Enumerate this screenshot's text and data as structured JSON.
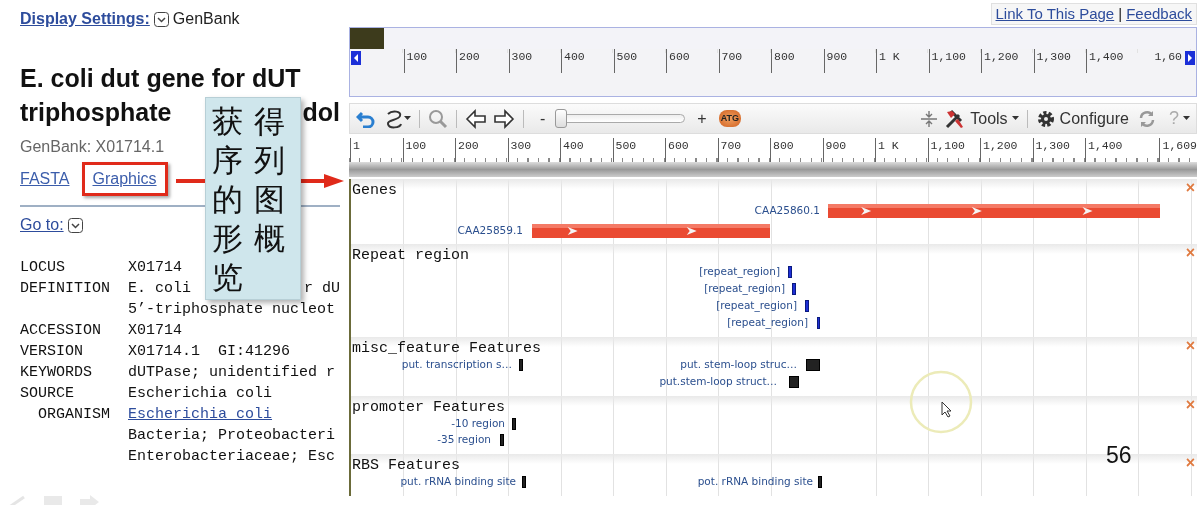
{
  "header": {
    "display_settings": "Display Settings:",
    "format": "GenBank"
  },
  "title_lines": [
    {
      "parts": [
        "E. coli dut gene for dUT"
      ]
    },
    {
      "parts": [
        "triphosphate",
        "dol"
      ]
    }
  ],
  "accession": "GenBank: X01714.1",
  "links": [
    {
      "label": "FASTA",
      "highlighted": false
    },
    {
      "label": "Graphics",
      "highlighted": true
    }
  ],
  "goto": "Go to:",
  "record": [
    {
      "key": "LOCUS",
      "lines": [
        {
          "kind": "text",
          "parts": [
            "X01714"
          ]
        }
      ]
    },
    {
      "key": "DEFINITION",
      "lines": [
        {
          "kind": "text",
          "parts": [
            "E. coli",
            "r dU"
          ]
        },
        {
          "kind": "text",
          "parts": [
            "5’-triphosphate nucleot"
          ]
        }
      ]
    },
    {
      "key": "ACCESSION",
      "lines": [
        {
          "kind": "text",
          "parts": [
            "X01714"
          ]
        }
      ]
    },
    {
      "key": "VERSION",
      "lines": [
        {
          "kind": "text",
          "parts": [
            "X01714.1  GI:41296"
          ]
        }
      ]
    },
    {
      "key": "KEYWORDS",
      "lines": [
        {
          "kind": "text",
          "parts": [
            "dUTPase; unidentified r"
          ]
        }
      ]
    },
    {
      "key": "SOURCE",
      "lines": [
        {
          "kind": "text",
          "parts": [
            "Escherichia coli"
          ]
        }
      ],
      "children": [
        {
          "key": "ORGANISM",
          "lines": [
            {
              "kind": "link",
              "parts": [
                "Escherichia coli"
              ]
            },
            {
              "kind": "text",
              "parts": [
                "Bacteria; Proteobacteri"
              ]
            },
            {
              "kind": "text",
              "parts": [
                "Enterobacteriaceae; Esc"
              ]
            }
          ]
        }
      ]
    }
  ],
  "callout": "获得序列的图形概览",
  "viewer": {
    "links": [
      "Link To This Page",
      "Feedback"
    ],
    "separator": "|",
    "overview_ticks": [
      "100",
      "200",
      "300",
      "400",
      "500",
      "600",
      "700",
      "800",
      "900",
      "1 K",
      "1,100",
      "1,200",
      "1,300",
      "1,400",
      "1,60"
    ],
    "toolbar": {
      "zoom_out": "-",
      "slider": {
        "level": 0
      },
      "zoom_in": "+",
      "sequence": "ATG",
      "tools": "Tools",
      "configure": "Configure",
      "help": "?"
    },
    "ruler_ticks": [
      "1",
      "100",
      "200",
      "300",
      "400",
      "500",
      "600",
      "700",
      "800",
      "900",
      "1 K",
      "1,100",
      "1,200",
      "1,300",
      "1,400",
      "1,609"
    ],
    "tracks": [
      {
        "title": "Genes",
        "close": "×",
        "features": [
          {
            "label": "CAA25860.1",
            "kind": "gene"
          },
          {
            "label": "CAA25859.1",
            "kind": "gene"
          }
        ]
      },
      {
        "title": "Repeat region",
        "close": "×",
        "features": [
          {
            "label": "[repeat_region]",
            "kind": "repeat"
          },
          {
            "label": "[repeat_region]",
            "kind": "repeat"
          },
          {
            "label": "[repeat_region]",
            "kind": "repeat"
          },
          {
            "label": "[repeat_region]",
            "kind": "repeat"
          }
        ]
      },
      {
        "title": "misc_feature Features",
        "close": "×",
        "features": [
          {
            "label": "put. transcription s…",
            "kind": "feature"
          },
          {
            "label": "put. stem-loop struc…",
            "kind": "feature"
          },
          {
            "label": "put.stem-loop struct…",
            "kind": "feature"
          }
        ]
      },
      {
        "title": "promoter Features",
        "close": "×",
        "features": [
          {
            "label": "-10 region",
            "kind": "feature"
          },
          {
            "label": "-35 region",
            "kind": "feature"
          }
        ]
      },
      {
        "title": "RBS Features",
        "close": "×",
        "features": [
          {
            "label": "put. rRNA binding site",
            "kind": "feature"
          },
          {
            "label": "pot. rRNA binding site",
            "kind": "feature"
          }
        ]
      }
    ]
  },
  "slide_number": "56"
}
